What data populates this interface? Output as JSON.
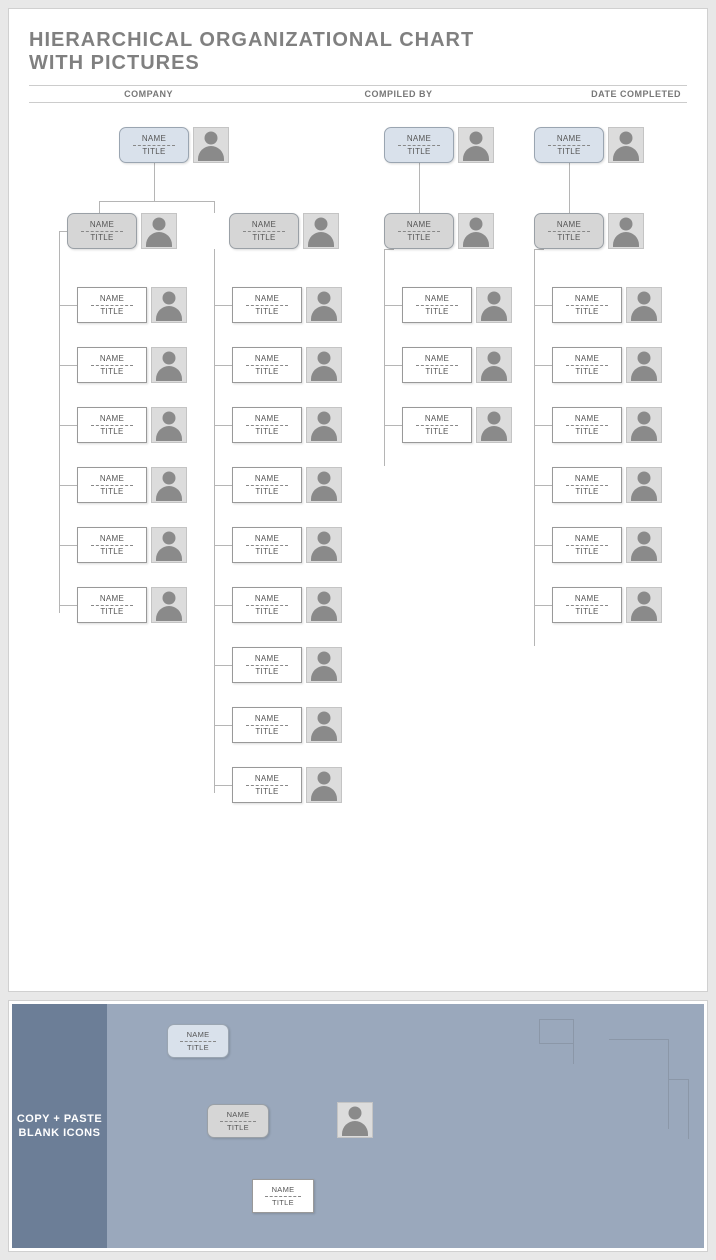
{
  "title_line1": "HIERARCHICAL ORGANIZATIONAL CHART",
  "title_line2": "WITH PICTURES",
  "headers": {
    "company": "COMPANY",
    "compiled_by": "COMPILED BY",
    "date_completed": "DATE COMPLETED"
  },
  "labels": {
    "name": "NAME",
    "title": "TITLE"
  },
  "palette_label_line1": "COPY + PASTE",
  "palette_label_line2": "BLANK ICONS",
  "chart_structure": {
    "columns": [
      {
        "top_style": "blue",
        "second_style": "gray",
        "second_offset": "left",
        "children": 6
      },
      {
        "top_style": null,
        "second_style": "gray",
        "second_offset": "center",
        "children": 9
      },
      {
        "top_style": "blue",
        "second_style": "gray",
        "second_offset": "center",
        "children": 3
      },
      {
        "top_style": "blue",
        "second_style": "gray",
        "second_offset": "center",
        "children": 6
      }
    ]
  },
  "palette_samples": [
    {
      "style": "blue"
    },
    {
      "style": "gray"
    },
    {
      "style": "white"
    }
  ]
}
